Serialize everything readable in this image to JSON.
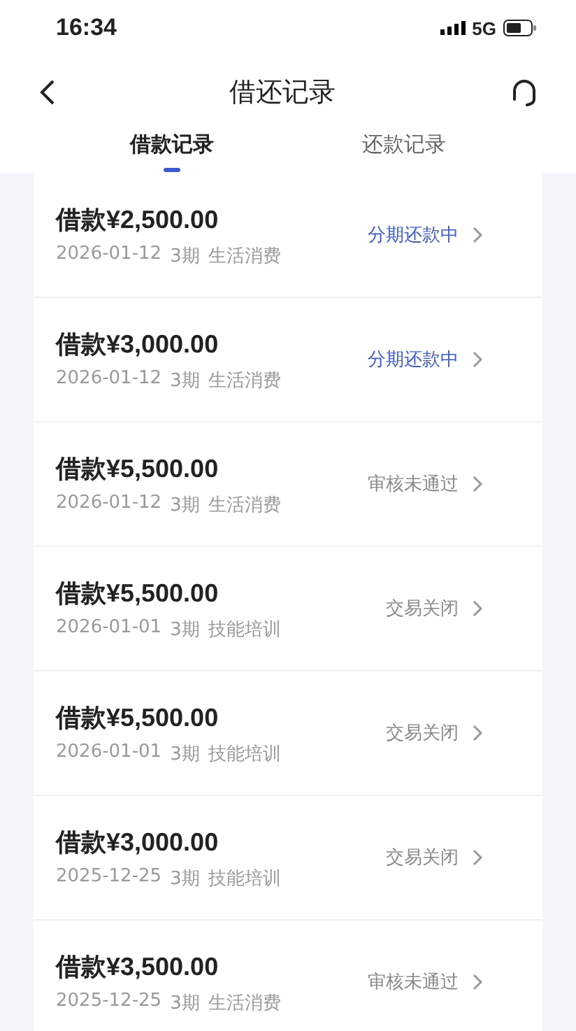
{
  "status_bar": {
    "time": "16:34",
    "network": "5G"
  },
  "header": {
    "title": "借还记录"
  },
  "tabs": [
    {
      "label": "借款记录",
      "selected": true
    },
    {
      "label": "还款记录",
      "selected": false
    }
  ],
  "records": [
    {
      "title": "借款¥2,500.00",
      "date": "2026-01-12",
      "term": "3期",
      "purpose": "生活消费",
      "status": "分期还款中",
      "color": "#3a5ad9"
    },
    {
      "title": "借款¥3,000.00",
      "date": "2026-01-12",
      "term": "3期",
      "purpose": "生活消费",
      "status": "分期还款中",
      "color": "#3a5ad9"
    },
    {
      "title": "借款¥5,500.00",
      "date": "2026-01-12",
      "term": "3期",
      "purpose": "生活消费",
      "status": "审核未通过",
      "color": "#888888"
    },
    {
      "title": "借款¥5,500.00",
      "date": "2026-01-01",
      "term": "3期",
      "purpose": "技能培训",
      "status": "交易关闭",
      "color": "#888888"
    },
    {
      "title": "借款¥5,500.00",
      "date": "2026-01-01",
      "term": "3期",
      "purpose": "技能培训",
      "status": "交易关闭",
      "color": "#888888"
    },
    {
      "title": "借款¥3,000.00",
      "date": "2025-12-25",
      "term": "3期",
      "purpose": "技能培训",
      "status": "交易关闭",
      "color": "#888888"
    },
    {
      "title": "借款¥3,500.00",
      "date": "2025-12-25",
      "term": "3期",
      "purpose": "生活消费",
      "status": "审核未通过",
      "color": "#888888"
    }
  ]
}
